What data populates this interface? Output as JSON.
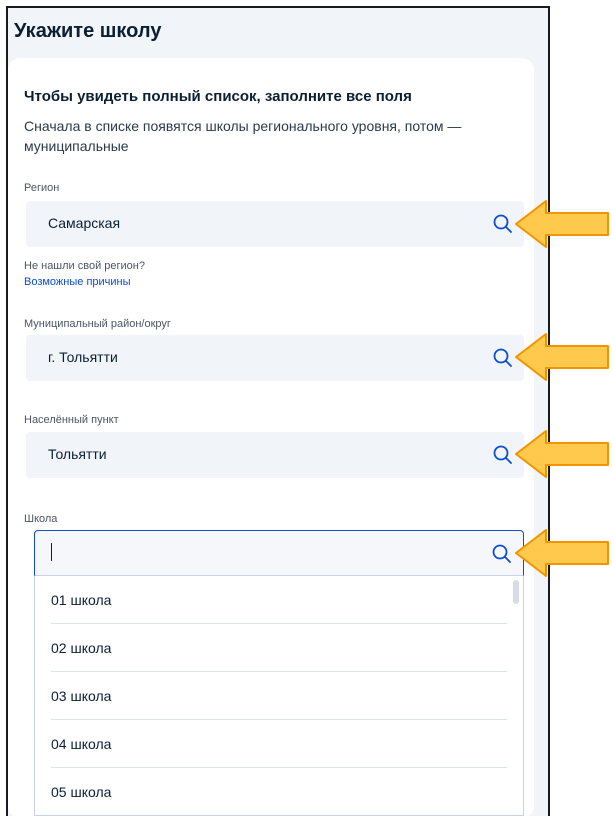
{
  "page": {
    "title": "Укажите школу"
  },
  "intro": {
    "subtitle": "Чтобы увидеть полный список, заполните все поля",
    "hint": "Сначала в списке появятся школы регионального уровня, потом — муниципальные"
  },
  "region": {
    "label": "Регион",
    "value": "Самарская",
    "not_found": "Не нашли свой регион?",
    "reasons_link": "Возможные причины"
  },
  "district": {
    "label": "Муниципальный район/округ",
    "value": "г. Тольятти"
  },
  "locality": {
    "label": "Населённый пункт",
    "value": "Тольятти"
  },
  "school": {
    "label": "Школа",
    "value": "",
    "options": [
      "01 школа",
      "02 школа",
      "03 школа",
      "04 школа",
      "05 школа"
    ]
  },
  "colors": {
    "accent": "#0d4cd3",
    "field_bg": "#f1f4f9",
    "arrow_fill": "#ffc94d",
    "arrow_stroke": "#f29400"
  },
  "icons": {
    "field_action": "search-icon",
    "annotation": "arrow-left-icon"
  }
}
